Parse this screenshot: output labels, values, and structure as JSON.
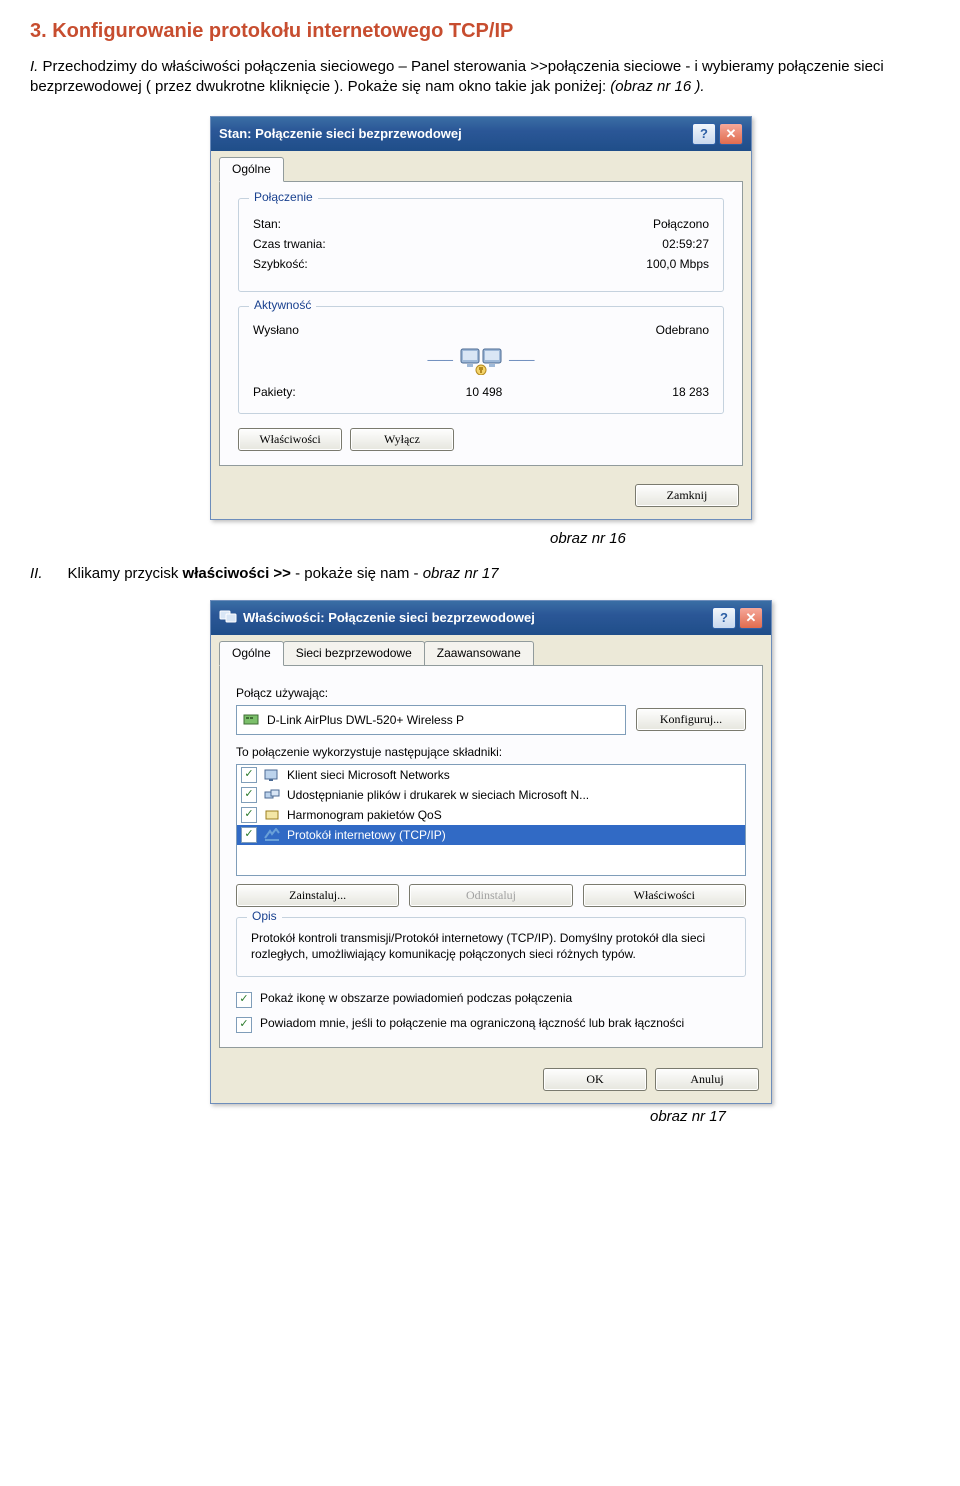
{
  "section": {
    "title": "3. Konfigurowanie protokołu internetowego TCP/IP"
  },
  "para1": {
    "roman": "I.",
    "t1": " Przechodzimy do właściwości połączenia sieciowego – Panel sterowania >>połączenia sieciowe - i wybieramy połączenie sieci bezprzewodowej ( przez dwukrotne kliknięcie ).   Pokaże się nam okno takie jak poniżej: ",
    "em": "(obraz nr 16 )."
  },
  "status_dialog": {
    "title": "Stan: Połączenie sieci bezprzewodowej",
    "tab": "Ogólne",
    "group_conn": "Połączenie",
    "stat_label": "Stan:",
    "stat_value": "Połączono",
    "dur_label": "Czas trwania:",
    "dur_value": "02:59:27",
    "spd_label": "Szybkość:",
    "spd_value": "100,0 Mbps",
    "group_act": "Aktywność",
    "sent": "Wysłano",
    "recv": "Odebrano",
    "pkt_label": "Pakiety:",
    "pkt_sent": "10 498",
    "pkt_recv": "18 283",
    "btn_props": "Właściwości",
    "btn_disable": "Wyłącz",
    "btn_close": "Zamknij"
  },
  "caption16": "obraz nr 16",
  "para2": {
    "roman": "II.",
    "t1": "Klikamy przycisk ",
    "btn": "właściwości >>",
    "t2": "   - pokaże się nam - ",
    "em": "obraz nr 17"
  },
  "props_dialog": {
    "title": "Właściwości: Połączenie sieci bezprzewodowej",
    "tabs": [
      "Ogólne",
      "Sieci bezprzewodowe",
      "Zaawansowane"
    ],
    "connect_using": "Połącz używając:",
    "device": "D-Link AirPlus DWL-520+ Wireless P",
    "btn_configure": "Konfiguruj...",
    "uses_label": "To połączenie wykorzystuje następujące składniki:",
    "components": [
      {
        "name": "Klient sieci Microsoft Networks",
        "icon": "client"
      },
      {
        "name": "Udostępnianie plików i drukarek w sieciach Microsoft N...",
        "icon": "share"
      },
      {
        "name": "Harmonogram pakietów QoS",
        "icon": "qos"
      },
      {
        "name": "Protokół internetowy (TCP/IP)",
        "icon": "proto",
        "selected": true
      }
    ],
    "btn_install": "Zainstaluj...",
    "btn_uninstall": "Odinstaluj",
    "btn_props": "Właściwości",
    "desc_title": "Opis",
    "desc_text": "Protokół kontroli transmisji/Protokół internetowy (TCP/IP). Domyślny protokół dla sieci rozległych, umożliwiający komunikację połączonych sieci różnych typów.",
    "chk1": "Pokaż ikonę w obszarze powiadomień podczas połączenia",
    "chk2": "Powiadom mnie, jeśli to połączenie ma ograniczoną łączność lub brak łączności",
    "btn_ok": "OK",
    "btn_cancel": "Anuluj"
  },
  "caption17": "obraz nr 17"
}
